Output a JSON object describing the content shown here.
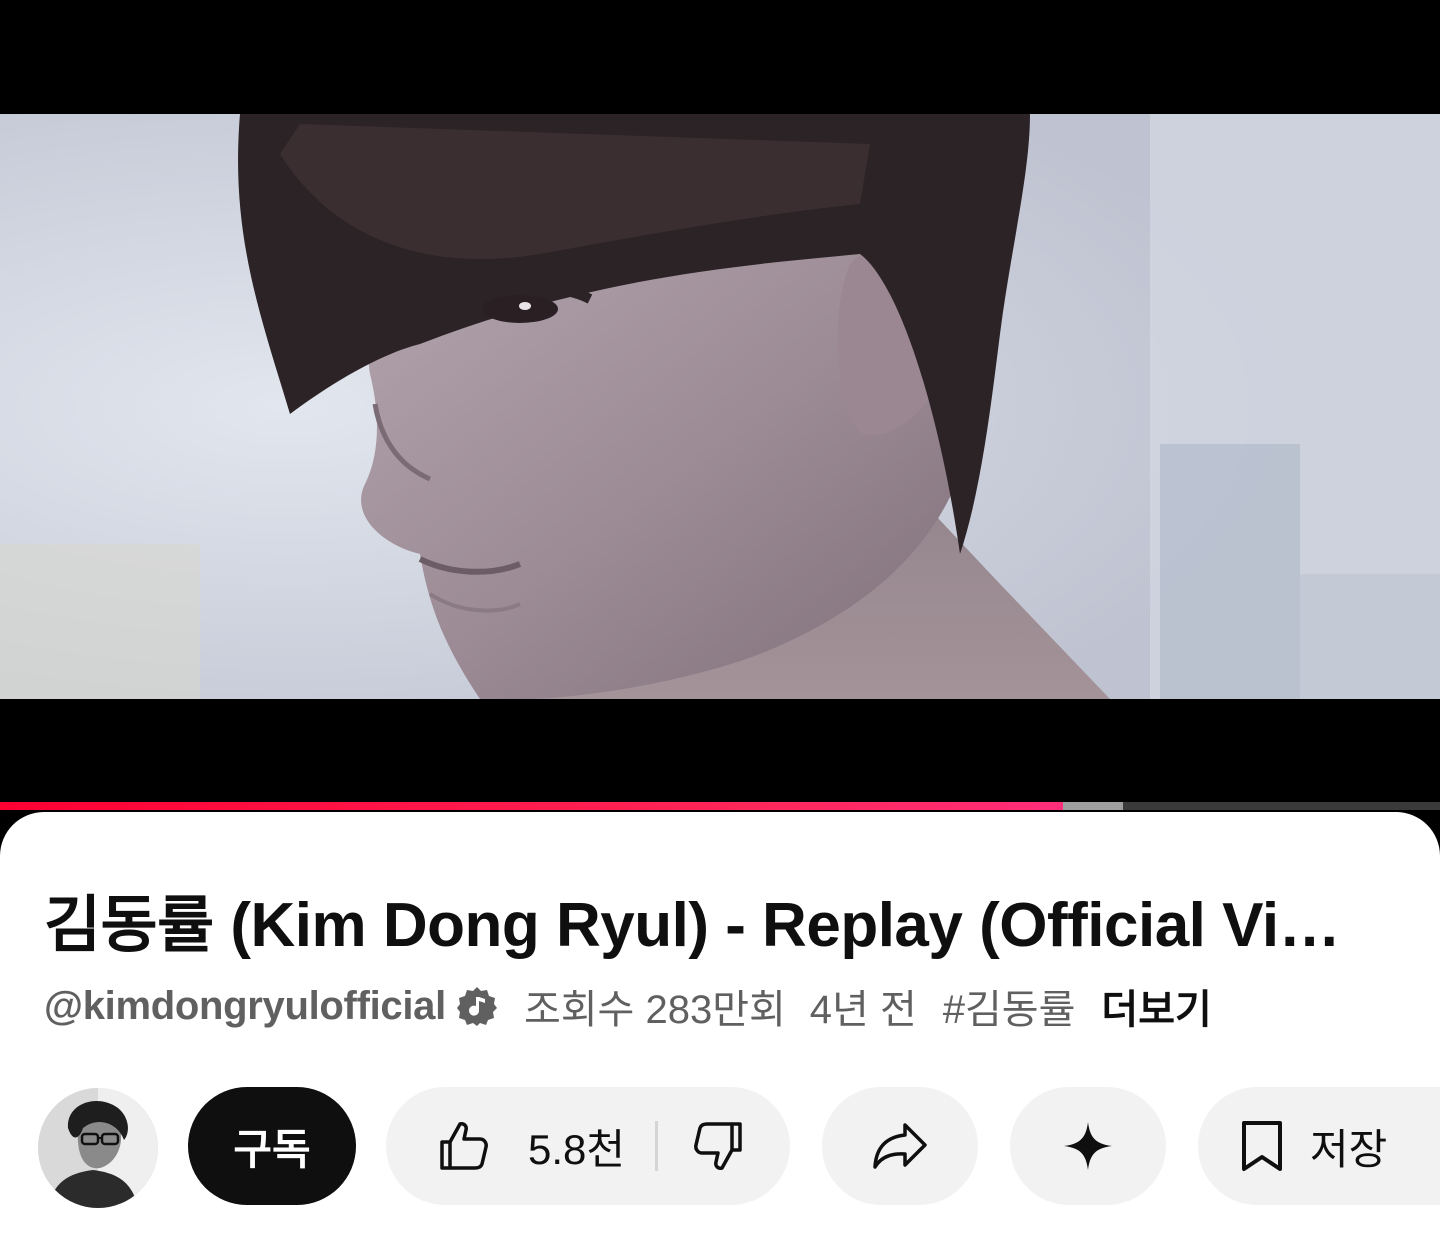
{
  "video": {
    "progress_played": 0.738,
    "progress_buffered": 0.78
  },
  "title": "김동률 (Kim Dong Ryul) - Replay (Official Vi…",
  "meta": {
    "channel_handle": "@kimdongryulofficial",
    "views": "조회수 283만회",
    "age": "4년 전",
    "hashtag": "#김동률",
    "more": "더보기"
  },
  "actions": {
    "subscribe_label": "구독",
    "like_count": "5.8천",
    "save_label": "저장"
  },
  "colors": {
    "progress": "#ff0033",
    "subscribe_bg": "#0f0f0f",
    "pill_bg": "#f2f2f2"
  }
}
